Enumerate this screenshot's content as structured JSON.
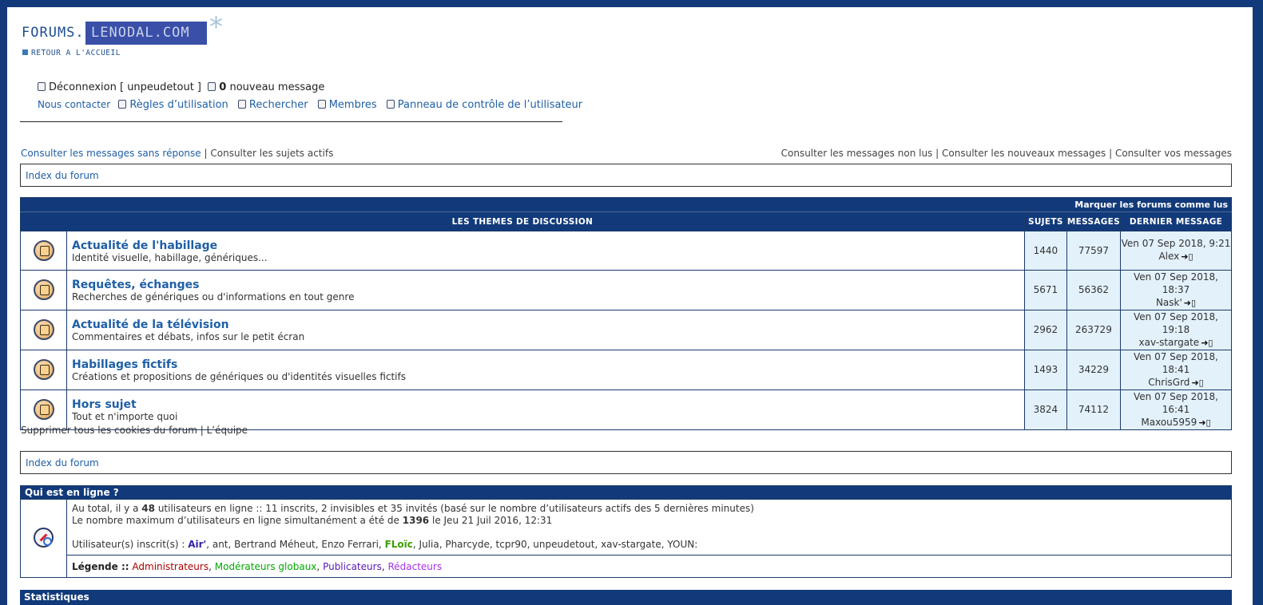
{
  "header": {
    "logo_left": "FORUMS.",
    "logo_right": "LENODAL.COM",
    "back_link": "RETOUR A L'ACCUEIL"
  },
  "userbar": {
    "logout": "Déconnexion [ unpeudetout ]",
    "new_count": "0",
    "new_label": "nouveau message"
  },
  "nav": {
    "contact": "Nous contacter",
    "rules": "Règles d’utilisation",
    "search": "Rechercher",
    "members": "Membres",
    "ucp": "Panneau de contrôle de l’utilisateur"
  },
  "subbar": {
    "unanswered": "Consulter les messages sans réponse",
    "sep": "|",
    "active": "Consulter les sujets actifs",
    "unread": "Consulter les messages non lus",
    "new_posts": "Consulter les nouveaux messages",
    "your_posts": "Consulter vos messages"
  },
  "breadcrumb": "Index du forum",
  "forum_table": {
    "mark_read": "Marquer les forums comme lus",
    "col_themes": "LES THEMES DE DISCUSSION",
    "col_topics": "SUJETS",
    "col_posts": "MESSAGES",
    "col_last": "DERNIER MESSAGE",
    "rows": [
      {
        "title": "Actualité de l'habillage",
        "desc": "Identité visuelle, habillage, génériques...",
        "topics": "1440",
        "posts": "77597",
        "last_date": "Ven 07 Sep 2018, 9:21",
        "last_user": "Alex"
      },
      {
        "title": "Requêtes, échanges",
        "desc": "Recherches de génériques ou d'informations en tout genre",
        "topics": "5671",
        "posts": "56362",
        "last_date": "Ven 07 Sep 2018, 18:37",
        "last_user": "Nask'"
      },
      {
        "title": "Actualité de la télévision",
        "desc": "Commentaires et débats, infos sur le petit écran",
        "topics": "2962",
        "posts": "263729",
        "last_date": "Ven 07 Sep 2018, 19:18",
        "last_user": "xav-stargate"
      },
      {
        "title": "Habillages fictifs",
        "desc": "Créations et propositions de génériques ou d'identités visuelles fictifs",
        "topics": "1493",
        "posts": "34229",
        "last_date": "Ven 07 Sep 2018, 18:41",
        "last_user": "ChrisGrd"
      },
      {
        "title": "Hors sujet",
        "desc": "Tout et n'importe quoi",
        "topics": "3824",
        "posts": "74112",
        "last_date": "Ven 07 Sep 2018, 16:41",
        "last_user": "Maxou5959"
      }
    ]
  },
  "footer_links": {
    "cookies": "Supprimer tous les cookies du forum",
    "sep": "|",
    "team": "L’équipe"
  },
  "who": {
    "title": "Qui est en ligne ?",
    "line1_a": "Au total, il y a",
    "line1_count": "48",
    "line1_b": "utilisateurs en ligne :: 11 inscrits, 2 invisibles et 35 invités (basé sur le nombre d’utilisateurs actifs des 5 dernières minutes)",
    "line2_a": "Le nombre maximum d’utilisateurs en ligne simultanément a été de",
    "line2_count": "1396",
    "line2_b": "le Jeu 21 Juil 2016, 12:31",
    "users_label": "Utilisateur(s) inscrit(s) :",
    "user_air": "Air'",
    "users_mid": ", ant, Bertrand Méheut, Enzo Ferrari,",
    "user_floic": "FLoïc",
    "users_end": ", Julia, Pharcyde, tcpr90, unpeudetout, xav-stargate, YOUN:",
    "legend_label": "Légende ::",
    "legend_admin": "Administrateurs",
    "legend_mod": "Modérateurs globaux",
    "legend_pub": "Publicateurs",
    "legend_red": "Rédacteurs",
    "comma": ","
  },
  "stats_title": "Statistiques",
  "colors": {
    "frame": "#123a7a",
    "link": "#1f5fa6",
    "cell_bg": "#e3f1fb",
    "admin": "#aa0000",
    "moderator": "#00aa00",
    "publisher": "#5a16b8",
    "editor": "#a630ea"
  }
}
